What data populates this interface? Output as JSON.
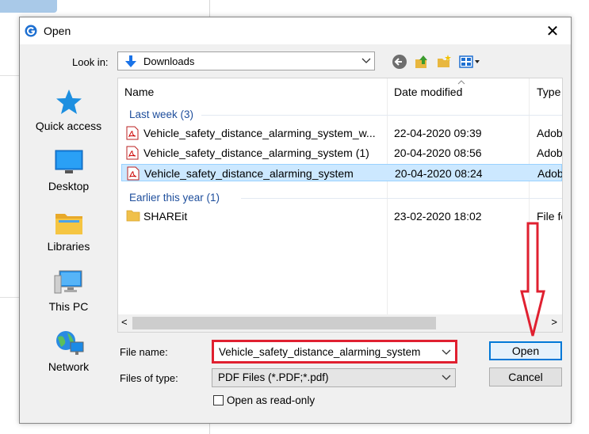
{
  "window": {
    "title": "Open",
    "close_glyph": "✕"
  },
  "look_in": {
    "label": "Look in:",
    "value": "Downloads"
  },
  "toolbar": {
    "icons": [
      "back-icon",
      "up-folder-icon",
      "new-folder-icon",
      "view-menu-icon"
    ]
  },
  "places": [
    {
      "label": "Quick access",
      "icon": "quick-access-star-icon"
    },
    {
      "label": "Desktop",
      "icon": "desktop-icon"
    },
    {
      "label": "Libraries",
      "icon": "libraries-icon"
    },
    {
      "label": "This PC",
      "icon": "this-pc-icon"
    },
    {
      "label": "Network",
      "icon": "network-icon"
    }
  ],
  "columns": {
    "name": "Name",
    "date": "Date modified",
    "type": "Type"
  },
  "groups": [
    {
      "label": "Last week (3)"
    },
    {
      "label": "Earlier this year (1)"
    }
  ],
  "files": [
    {
      "name": "Vehicle_safety_distance_alarming_system_w...",
      "date": "22-04-2020 09:39",
      "type": "Adob",
      "icon": "pdf-icon",
      "selected": false
    },
    {
      "name": "Vehicle_safety_distance_alarming_system (1)",
      "date": "20-04-2020 08:56",
      "type": "Adob",
      "icon": "pdf-icon",
      "selected": false
    },
    {
      "name": "Vehicle_safety_distance_alarming_system",
      "date": "20-04-2020 08:24",
      "type": "Adob",
      "icon": "pdf-icon",
      "selected": true
    },
    {
      "name": "SHAREit",
      "date": "23-02-2020 18:02",
      "type": "File fo",
      "icon": "folder-icon",
      "selected": false
    }
  ],
  "scroll": {
    "left": "<",
    "right": ">"
  },
  "file_name": {
    "label": "File name:",
    "value": "Vehicle_safety_distance_alarming_system"
  },
  "file_type": {
    "label": "Files of type:",
    "value": "PDF Files (*.PDF;*.pdf)"
  },
  "buttons": {
    "open": "Open",
    "cancel": "Cancel"
  },
  "read_only": {
    "label": "Open as read-only"
  },
  "colors": {
    "selection": "#cce8ff",
    "group_text": "#1e4e9c",
    "highlight_red": "#e02030",
    "default_button_border": "#0078d7"
  }
}
